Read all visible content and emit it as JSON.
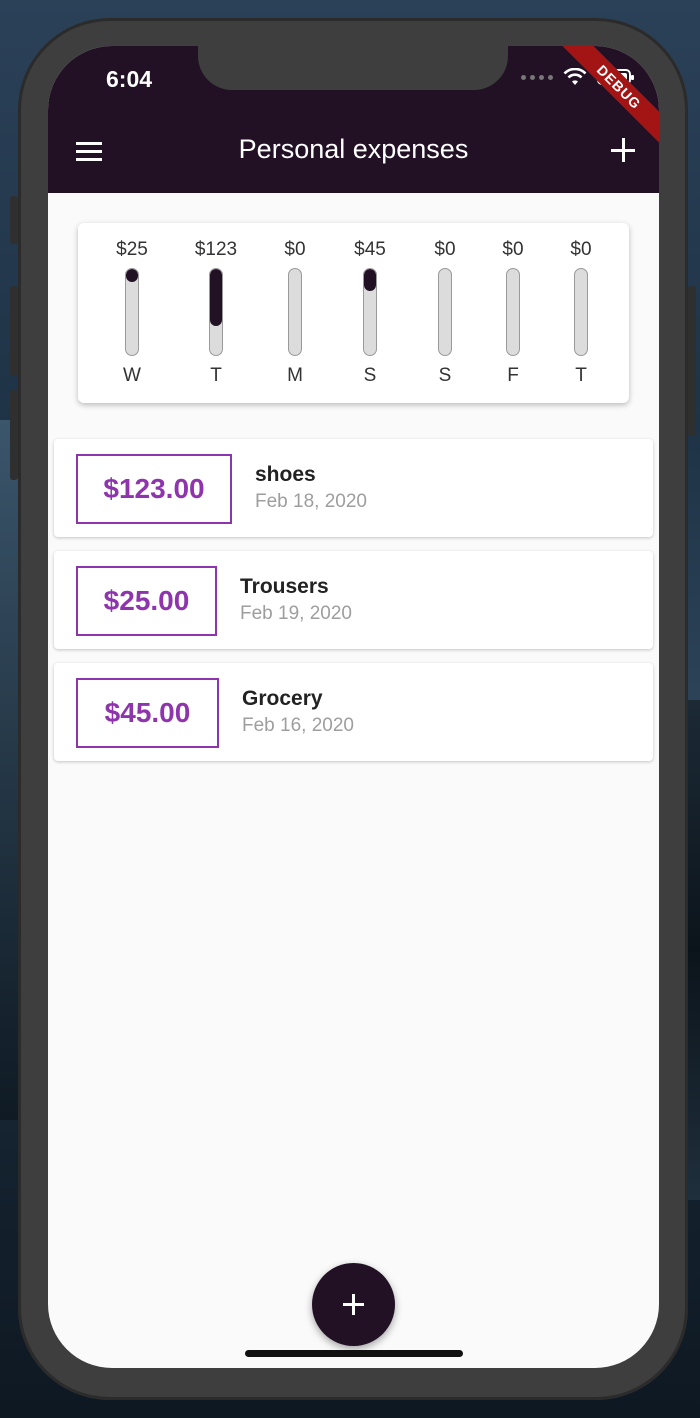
{
  "status_bar": {
    "time": "6:04"
  },
  "debug_banner": "DEBUG",
  "app_bar": {
    "title": "Personal expenses"
  },
  "chart": [
    {
      "day": "W",
      "amount": "$25",
      "fraction": 0.15
    },
    {
      "day": "T",
      "amount": "$123",
      "fraction": 0.65
    },
    {
      "day": "M",
      "amount": "$0",
      "fraction": 0.0
    },
    {
      "day": "S",
      "amount": "$45",
      "fraction": 0.25
    },
    {
      "day": "S",
      "amount": "$0",
      "fraction": 0.0
    },
    {
      "day": "F",
      "amount": "$0",
      "fraction": 0.0
    },
    {
      "day": "T",
      "amount": "$0",
      "fraction": 0.0
    }
  ],
  "transactions": [
    {
      "amount": "$123.00",
      "title": "shoes",
      "date": "Feb 18, 2020"
    },
    {
      "amount": "$25.00",
      "title": "Trousers",
      "date": "Feb 19, 2020"
    },
    {
      "amount": "$45.00",
      "title": "Grocery",
      "date": "Feb 16, 2020"
    }
  ],
  "colors": {
    "primary": "#221124",
    "accent": "#8e35ae",
    "debug": "#a31515"
  },
  "icons": {
    "menu": "menu-icon",
    "add": "add-icon",
    "fab": "plus-icon"
  }
}
